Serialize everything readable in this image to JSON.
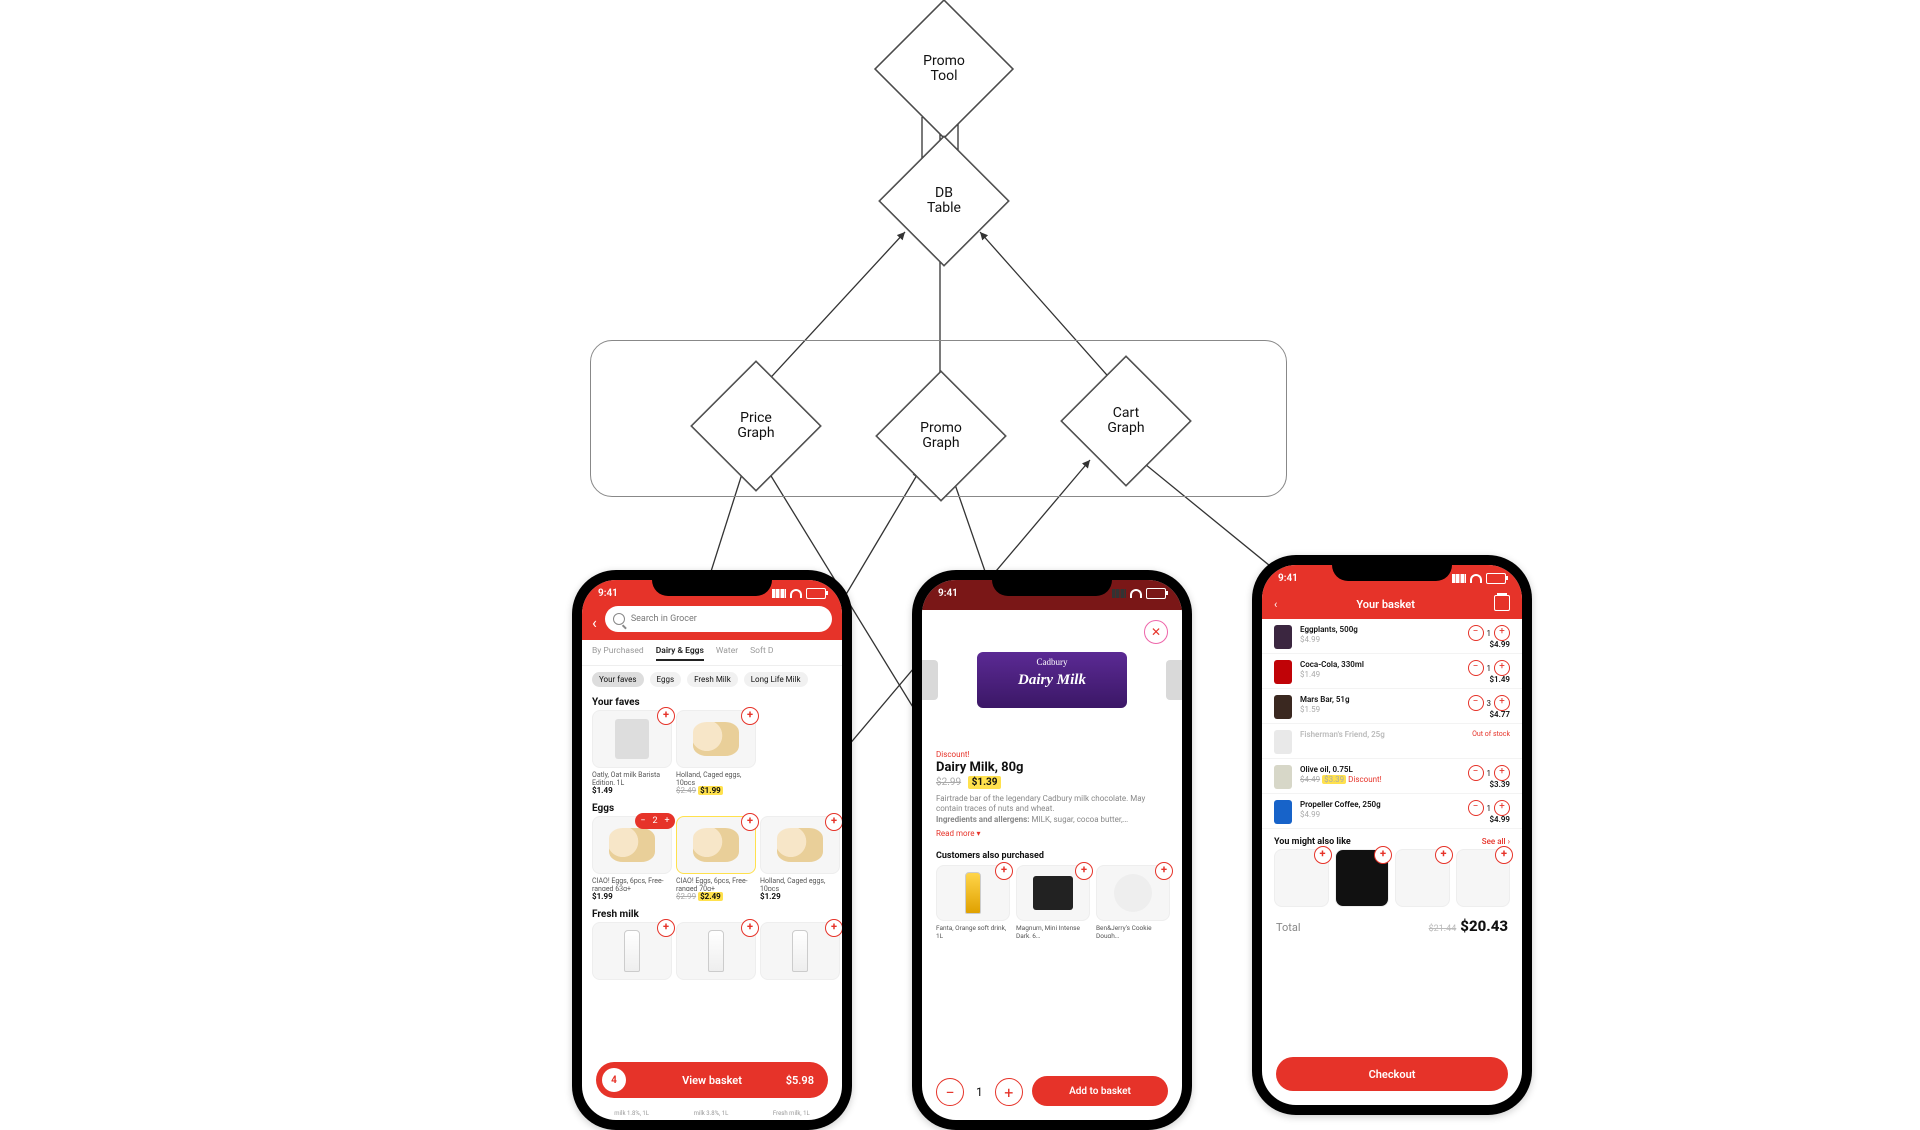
{
  "nodes": {
    "promo_tool": "Promo\nTool",
    "db_table": "DB\nTable",
    "price_graph": "Price\nGraph",
    "promo_graph": "Promo\nGraph",
    "cart_graph": "Cart\nGraph"
  },
  "phone1": {
    "time": "9:41",
    "search_placeholder": "Search in Grocer",
    "tabs": [
      "By Purchased",
      "Dairy & Eggs",
      "Water",
      "Soft D"
    ],
    "active_tab": "Dairy & Eggs",
    "chips": [
      "Your faves",
      "Eggs",
      "Fresh Milk",
      "Long Life Milk"
    ],
    "sections": {
      "faves": {
        "title": "Your faves",
        "items": [
          {
            "name": "Oatly, Oat milk Barista Edition, 1L",
            "price": "$1.49"
          },
          {
            "name": "Holland, Caged eggs, 10pcs",
            "old": "$2.49",
            "price": "$1.99"
          }
        ]
      },
      "eggs": {
        "title": "Eggs",
        "items": [
          {
            "name": "CIAO!\nEggs, 6pcs, Free-ranged 63g+",
            "price": "$1.99",
            "qty": 2
          },
          {
            "name": "CIAO!\nEggs, 6pcs, Free-ranged 70g+",
            "old": "$2.99",
            "price": "$2.49"
          },
          {
            "name": "Holland, Caged eggs, 10pcs",
            "price": "$1.29"
          }
        ]
      },
      "milk": {
        "title": "Fresh milk",
        "items": [
          {
            "name": "milk 1.8%, 1L"
          },
          {
            "name": "milk 3.8%, 1L"
          },
          {
            "name": "Fresh milk, 1L"
          }
        ]
      }
    },
    "basket": {
      "count": "4",
      "label": "View basket",
      "total": "$5.98"
    }
  },
  "phone2": {
    "time": "9:41",
    "discount_label": "Discount!",
    "title": "Dairy Milk, 80g",
    "old_price": "$2.99",
    "price": "$1.39",
    "brand_top": "Cadbury",
    "brand_main": "Dairy Milk",
    "desc": "Fairtrade bar of the legendary Cadbury milk chocolate. May contain traces of nuts and wheat.",
    "ingredients_label": "Ingredients and allergens:",
    "ingredients": "MILK, sugar, cocoa butter,…",
    "read_more": "Read more ▾",
    "also_title": "Customers also purchased",
    "also": [
      {
        "name": "Fanta, Orange soft drink, 1L"
      },
      {
        "name": "Magnum, Mini Intense Dark, 6…"
      },
      {
        "name": "Ben&Jerry's Cookie Dough…"
      }
    ],
    "qty": "1",
    "add_label": "Add to basket"
  },
  "phone3": {
    "time": "9:41",
    "title": "Your basket",
    "items": [
      {
        "name": "Eggplants, 500g",
        "unit": "$4.99",
        "qty": "1",
        "total": "$4.99"
      },
      {
        "name": "Coca-Cola, 330ml",
        "unit": "$1.49",
        "qty": "1",
        "total": "$1.49"
      },
      {
        "name": "Mars Bar, 51g",
        "unit": "$1.59",
        "qty": "3",
        "total": "$4.77"
      },
      {
        "name": "Fisherman's Friend, 25g",
        "flag": "Out of stock"
      },
      {
        "name": "Olive oil, 0.75L",
        "unit": "$4.49",
        "disc": "$3.39",
        "badge": "Discount!",
        "qty": "1",
        "total": "$3.39"
      },
      {
        "name": "Propeller Coffee, 250g",
        "unit": "$4.99",
        "qty": "1",
        "total": "$4.99"
      }
    ],
    "also_title": "You might also like",
    "also_link": "See all ›",
    "total_label": "Total",
    "total_old": "$21.44",
    "total": "$20.43",
    "checkout": "Checkout"
  }
}
